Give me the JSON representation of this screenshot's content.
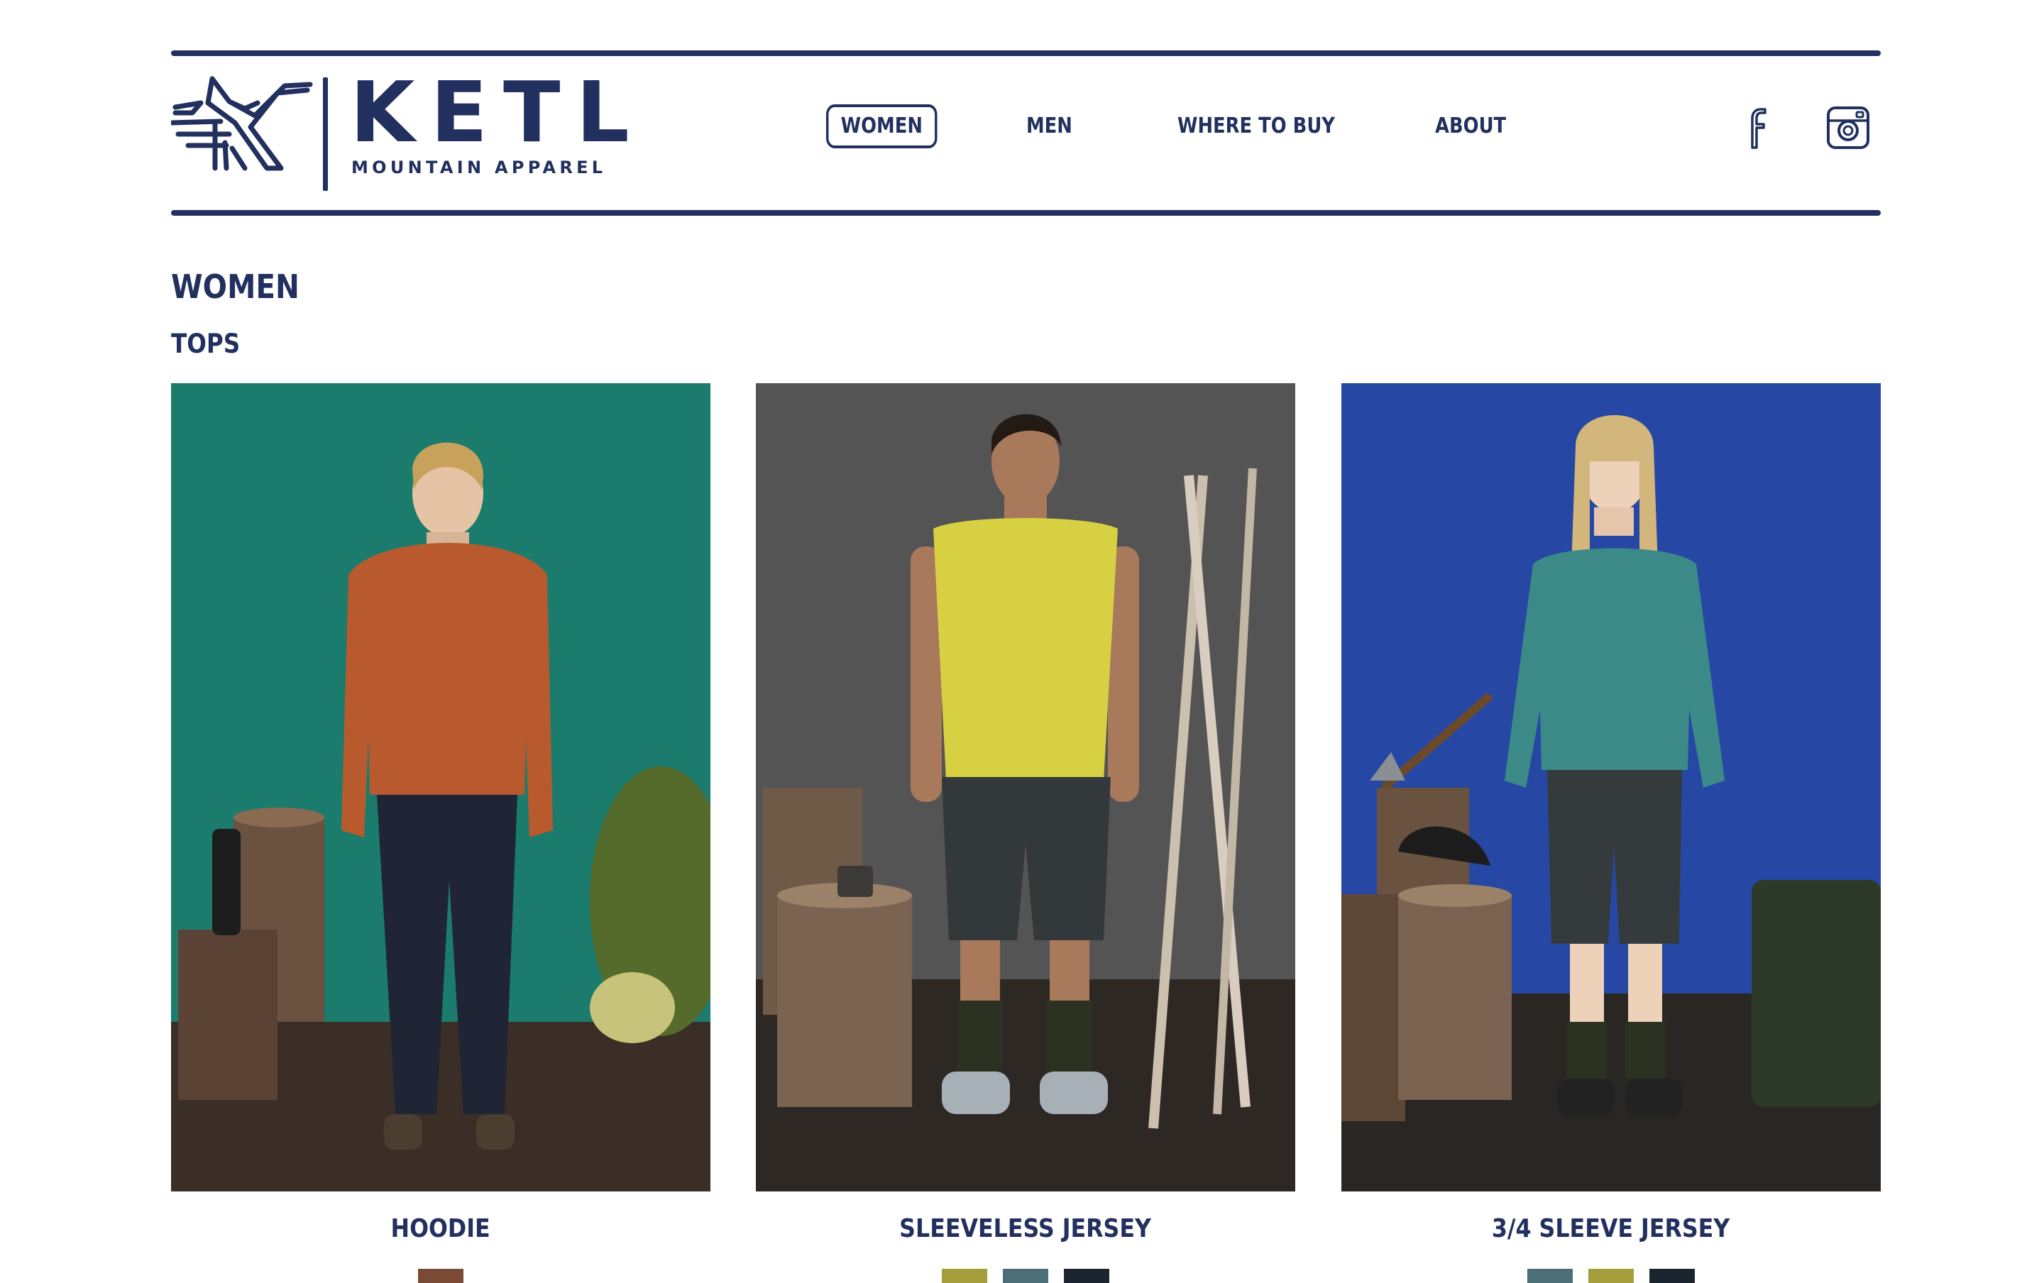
{
  "brand": {
    "name": "KETL",
    "tagline": "MOUNTAIN APPAREL",
    "color": "#22305f"
  },
  "nav": {
    "items": [
      {
        "label": "WOMEN",
        "active": true
      },
      {
        "label": "MEN",
        "active": false
      },
      {
        "label": "WHERE TO BUY",
        "active": false
      },
      {
        "label": "ABOUT",
        "active": false
      }
    ]
  },
  "social": {
    "icons": [
      "facebook-icon",
      "instagram-icon"
    ]
  },
  "page": {
    "title": "WOMEN",
    "category": "TOPS"
  },
  "products": [
    {
      "name": "HOODIE",
      "backdrop": "#1b7b6c",
      "swatches": [
        "#7a4a34"
      ]
    },
    {
      "name": "SLEEVELESS JERSEY",
      "backdrop": "#525252",
      "swatches": [
        "#a39d3a",
        "#4c6e76",
        "#1b2530"
      ]
    },
    {
      "name": "3/4 SLEEVE JERSEY",
      "backdrop": "#2648a4",
      "swatches": [
        "#4c6e76",
        "#a39d3a",
        "#1b2530"
      ]
    }
  ]
}
